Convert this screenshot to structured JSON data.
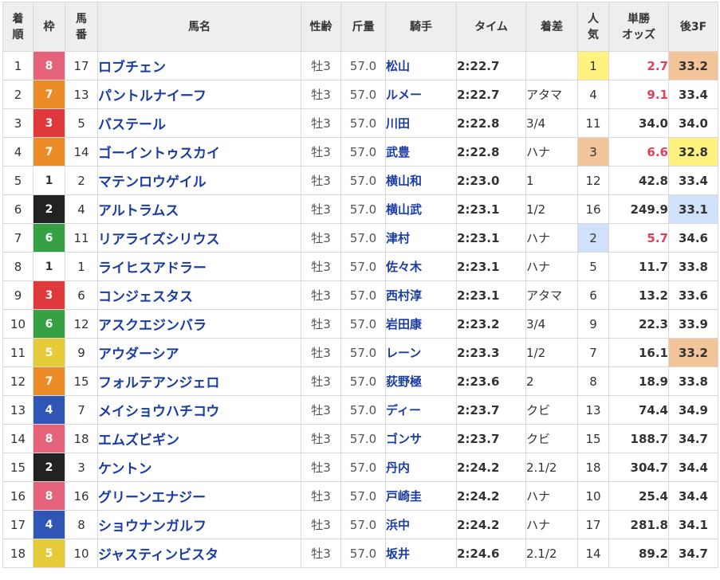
{
  "headers": {
    "rank": "着\n順",
    "waku": "枠",
    "umaban": "馬\n番",
    "name": "馬名",
    "sexage": "性齢",
    "weight": "斤量",
    "jockey": "騎手",
    "time": "タイム",
    "margin": "着差",
    "popularity": "人\n気",
    "odds": "単勝\nオッズ",
    "last3f": "後3F"
  },
  "waku_colors": {
    "1": "#ffffff",
    "2": "#222222",
    "3": "#e0393b",
    "4": "#2f55b5",
    "5": "#e6cb38",
    "6": "#37a044",
    "7": "#eb8b26",
    "8": "#e4627a"
  },
  "highlight_colors": {
    "gold": "#fff27f",
    "tan": "#f2c49a",
    "blue": "#cfe1fb"
  },
  "rows": [
    {
      "rank": "1",
      "waku": "8",
      "num": "17",
      "name": "ロブチェン",
      "sexage": "牡3",
      "weight": "57.0",
      "jockey": "松山",
      "time": "2:22.7",
      "margin": "",
      "pop": "1",
      "odds": "2.7",
      "l3f": "33.2"
    },
    {
      "rank": "2",
      "waku": "7",
      "num": "13",
      "name": "パントルナイーフ",
      "sexage": "牡3",
      "weight": "57.0",
      "jockey": "ルメー",
      "time": "2:22.7",
      "margin": "アタマ",
      "pop": "4",
      "odds": "9.1",
      "l3f": "33.4"
    },
    {
      "rank": "3",
      "waku": "3",
      "num": "5",
      "name": "バステール",
      "sexage": "牡3",
      "weight": "57.0",
      "jockey": "川田",
      "time": "2:22.8",
      "margin": "3/4",
      "pop": "11",
      "odds": "34.0",
      "l3f": "34.0"
    },
    {
      "rank": "4",
      "waku": "7",
      "num": "14",
      "name": "ゴーイントゥスカイ",
      "sexage": "牡3",
      "weight": "57.0",
      "jockey": "武豊",
      "time": "2:22.8",
      "margin": "ハナ",
      "pop": "3",
      "odds": "6.6",
      "l3f": "32.8"
    },
    {
      "rank": "5",
      "waku": "1",
      "num": "2",
      "name": "マテンロウゲイル",
      "sexage": "牡3",
      "weight": "57.0",
      "jockey": "横山和",
      "time": "2:23.0",
      "margin": "1",
      "pop": "12",
      "odds": "42.8",
      "l3f": "33.4"
    },
    {
      "rank": "6",
      "waku": "2",
      "num": "4",
      "name": "アルトラムス",
      "sexage": "牡3",
      "weight": "57.0",
      "jockey": "横山武",
      "time": "2:23.1",
      "margin": "1/2",
      "pop": "16",
      "odds": "249.9",
      "l3f": "33.1"
    },
    {
      "rank": "7",
      "waku": "6",
      "num": "11",
      "name": "リアライズシリウス",
      "sexage": "牡3",
      "weight": "57.0",
      "jockey": "津村",
      "time": "2:23.1",
      "margin": "ハナ",
      "pop": "2",
      "odds": "5.7",
      "l3f": "34.6"
    },
    {
      "rank": "8",
      "waku": "1",
      "num": "1",
      "name": "ライヒスアドラー",
      "sexage": "牡3",
      "weight": "57.0",
      "jockey": "佐々木",
      "time": "2:23.1",
      "margin": "ハナ",
      "pop": "5",
      "odds": "11.7",
      "l3f": "33.8"
    },
    {
      "rank": "9",
      "waku": "3",
      "num": "6",
      "name": "コンジェスタス",
      "sexage": "牡3",
      "weight": "57.0",
      "jockey": "西村淳",
      "time": "2:23.1",
      "margin": "アタマ",
      "pop": "6",
      "odds": "13.2",
      "l3f": "33.6"
    },
    {
      "rank": "10",
      "waku": "6",
      "num": "12",
      "name": "アスクエジンバラ",
      "sexage": "牡3",
      "weight": "57.0",
      "jockey": "岩田康",
      "time": "2:23.2",
      "margin": "3/4",
      "pop": "9",
      "odds": "22.3",
      "l3f": "33.9"
    },
    {
      "rank": "11",
      "waku": "5",
      "num": "9",
      "name": "アウダーシア",
      "sexage": "牡3",
      "weight": "57.0",
      "jockey": "レーン",
      "time": "2:23.3",
      "margin": "1/2",
      "pop": "7",
      "odds": "16.1",
      "l3f": "33.2"
    },
    {
      "rank": "12",
      "waku": "7",
      "num": "15",
      "name": "フォルテアンジェロ",
      "sexage": "牡3",
      "weight": "57.0",
      "jockey": "荻野極",
      "time": "2:23.6",
      "margin": "2",
      "pop": "8",
      "odds": "18.9",
      "l3f": "33.8"
    },
    {
      "rank": "13",
      "waku": "4",
      "num": "7",
      "name": "メイショウハチコウ",
      "sexage": "牡3",
      "weight": "57.0",
      "jockey": "ディー",
      "time": "2:23.7",
      "margin": "クビ",
      "pop": "13",
      "odds": "74.4",
      "l3f": "34.9"
    },
    {
      "rank": "14",
      "waku": "8",
      "num": "18",
      "name": "エムズビギン",
      "sexage": "牡3",
      "weight": "57.0",
      "jockey": "ゴンサ",
      "time": "2:23.7",
      "margin": "クビ",
      "pop": "15",
      "odds": "188.7",
      "l3f": "34.7"
    },
    {
      "rank": "15",
      "waku": "2",
      "num": "3",
      "name": "ケントン",
      "sexage": "牡3",
      "weight": "57.0",
      "jockey": "丹内",
      "time": "2:24.2",
      "margin": "2.1/2",
      "pop": "18",
      "odds": "304.7",
      "l3f": "34.4"
    },
    {
      "rank": "16",
      "waku": "8",
      "num": "16",
      "name": "グリーンエナジー",
      "sexage": "牡3",
      "weight": "57.0",
      "jockey": "戸崎圭",
      "time": "2:24.2",
      "margin": "ハナ",
      "pop": "10",
      "odds": "25.4",
      "l3f": "34.4"
    },
    {
      "rank": "17",
      "waku": "4",
      "num": "8",
      "name": "ショウナンガルフ",
      "sexage": "牡3",
      "weight": "57.0",
      "jockey": "浜中",
      "time": "2:24.2",
      "margin": "ハナ",
      "pop": "17",
      "odds": "281.8",
      "l3f": "34.1"
    },
    {
      "rank": "18",
      "waku": "5",
      "num": "10",
      "name": "ジャスティンビスタ",
      "sexage": "牡3",
      "weight": "57.0",
      "jockey": "坂井",
      "time": "2:24.6",
      "margin": "2.1/2",
      "pop": "14",
      "odds": "89.2",
      "l3f": "34.7"
    }
  ],
  "popularity_highlights": {
    "1": "gold",
    "2": "blue",
    "3": "tan"
  },
  "last3f_highlights": {
    "32.8": "gold",
    "33.1": "blue",
    "33.2": "tan"
  }
}
